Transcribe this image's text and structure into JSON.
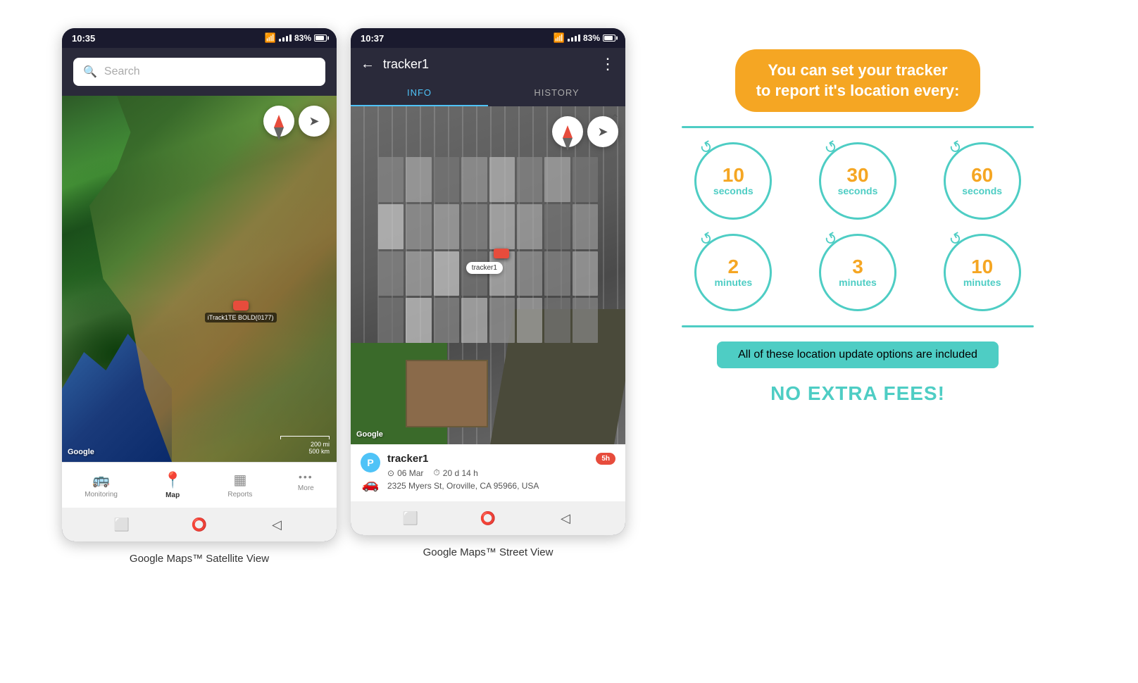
{
  "phone1": {
    "status_time": "10:35",
    "status_percent": "83%",
    "search_placeholder": "Search",
    "map_label": "iTrack1TE BOLD(0177)",
    "scale_line1": "200 mi",
    "scale_line2": "500 km",
    "google_logo": "Google",
    "nav_items": [
      {
        "id": "monitoring",
        "label": "Monitoring",
        "icon": "🚌"
      },
      {
        "id": "map",
        "label": "Map",
        "icon": "📍",
        "active": true
      },
      {
        "id": "reports",
        "label": "Reports",
        "icon": "▦"
      },
      {
        "id": "more",
        "label": "More",
        "icon": "···"
      }
    ],
    "caption": "Google Maps™ Satellite View"
  },
  "phone2": {
    "status_time": "10:37",
    "status_percent": "83%",
    "tracker_name": "tracker1",
    "tabs": [
      {
        "id": "info",
        "label": "INFO",
        "active": true
      },
      {
        "id": "history",
        "label": "HISTORY",
        "active": false
      }
    ],
    "google_logo": "Google",
    "info": {
      "tracker_name": "tracker1",
      "date": "06 Mar",
      "duration": "20 d 14 h",
      "address": "2325 Myers St, Oroville, CA 95966, USA",
      "time_badge": "5h"
    },
    "caption": "Google Maps™ Street View"
  },
  "tracker_panel": {
    "headline_line1": "You can set your tracker",
    "headline_line2": "to report it's location every:",
    "circles": [
      {
        "number": "10",
        "unit": "seconds"
      },
      {
        "number": "30",
        "unit": "seconds"
      },
      {
        "number": "60",
        "unit": "seconds"
      },
      {
        "number": "2",
        "unit": "minutes"
      },
      {
        "number": "3",
        "unit": "minutes"
      },
      {
        "number": "10",
        "unit": "minutes"
      }
    ],
    "banner_text": "All of these location update options are included",
    "no_fees_label": "NO EXTRA FEES!"
  }
}
